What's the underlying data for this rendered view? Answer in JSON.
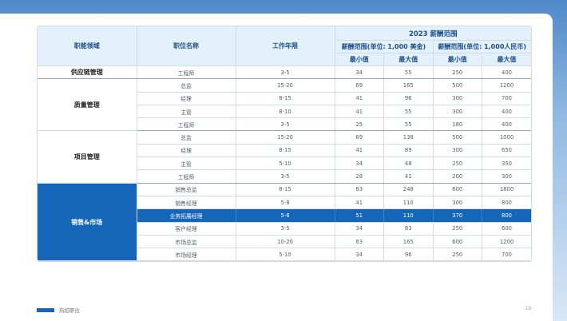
{
  "table": {
    "headers": {
      "domain": "职能领域",
      "position": "职位名称",
      "years": "工作年限",
      "salary_range_title": "2023 薪酬范围",
      "usd_group": "薪酬范围(单位: 1,000 美金)",
      "rmb_group": "薪酬范围(单位: 1,000人民币)",
      "min": "最小值",
      "max": "最大值"
    },
    "rows": [
      {
        "domain": "供应链管理",
        "span": 1,
        "position": "工程师",
        "years": "3-5",
        "usd_min": "34",
        "usd_max": "55",
        "rmb_min": "250",
        "rmb_max": "400"
      },
      {
        "domain": "质量管理",
        "span": 4,
        "position": "总监",
        "years": "15-20",
        "usd_min": "69",
        "usd_max": "165",
        "rmb_min": "500",
        "rmb_max": "1200"
      },
      {
        "position": "经理",
        "years": "8-15",
        "usd_min": "41",
        "usd_max": "96",
        "rmb_min": "300",
        "rmb_max": "700"
      },
      {
        "position": "主管",
        "years": "8-10",
        "usd_min": "41",
        "usd_max": "55",
        "rmb_min": "300",
        "rmb_max": "400"
      },
      {
        "position": "工程师",
        "years": "3-5",
        "usd_min": "25",
        "usd_max": "55",
        "rmb_min": "180",
        "rmb_max": "400"
      },
      {
        "domain": "项目管理",
        "span": 4,
        "position": "总监",
        "years": "15-20",
        "usd_min": "69",
        "usd_max": "138",
        "rmb_min": "500",
        "rmb_max": "1000"
      },
      {
        "position": "经理",
        "years": "8-15",
        "usd_min": "41",
        "usd_max": "89",
        "rmb_min": "300",
        "rmb_max": "650"
      },
      {
        "position": "主管",
        "years": "5-10",
        "usd_min": "34",
        "usd_max": "48",
        "rmb_min": "250",
        "rmb_max": "350"
      },
      {
        "position": "工程师",
        "years": "3-5",
        "usd_min": "28",
        "usd_max": "41",
        "rmb_min": "200",
        "rmb_max": "300"
      },
      {
        "domain": "销售&市场",
        "span": 6,
        "blue": true,
        "position": "销售总监",
        "years": "8-15",
        "usd_min": "83",
        "usd_max": "248",
        "rmb_min": "600",
        "rmb_max": "1800"
      },
      {
        "position": "销售经理",
        "years": "5-8",
        "usd_min": "41",
        "usd_max": "110",
        "rmb_min": "300",
        "rmb_max": "800"
      },
      {
        "position": "业务拓展经理",
        "years": "5-8",
        "usd_min": "51",
        "usd_max": "110",
        "rmb_min": "370",
        "rmb_max": "800",
        "highlight": true
      },
      {
        "position": "客户经理",
        "years": "3-5",
        "usd_min": "34",
        "usd_max": "83",
        "rmb_min": "250",
        "rmb_max": "600"
      },
      {
        "position": "市场总监",
        "years": "10-20",
        "usd_min": "83",
        "usd_max": "165",
        "rmb_min": "600",
        "rmb_max": "1200"
      },
      {
        "position": "市场经理",
        "years": "5-10",
        "usd_min": "34",
        "usd_max": "96",
        "rmb_min": "250",
        "rmb_max": "700"
      }
    ]
  },
  "legend": {
    "label": "热招职位",
    "color": "#1565b8"
  },
  "page_number": "19"
}
